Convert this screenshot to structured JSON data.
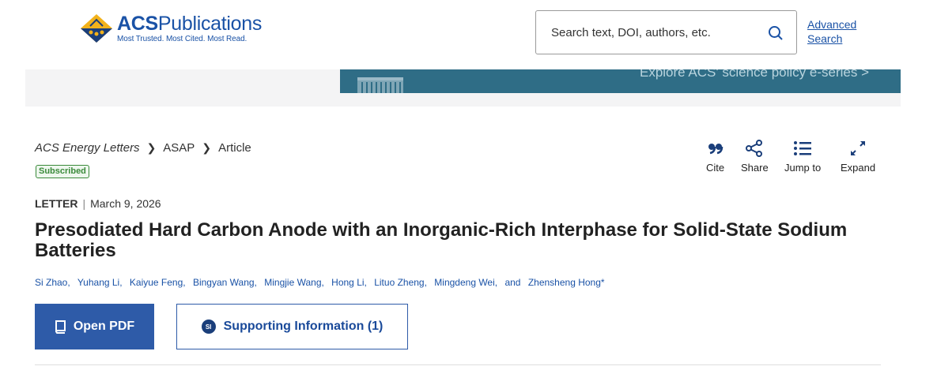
{
  "header": {
    "logo_title_bold": "ACS",
    "logo_title_rest": "Publications",
    "logo_tagline": "Most Trusted. Most Cited. Most Read.",
    "search_placeholder": "Search text, DOI, authors, etc.",
    "advanced_search": "Advanced Search"
  },
  "banner": {
    "text": "Explore ACS' science policy e-series >"
  },
  "breadcrumb": {
    "journal": "ACS Energy Letters",
    "section": "ASAP",
    "page": "Article"
  },
  "badge": "Subscribed",
  "tools": {
    "cite": "Cite",
    "share": "Share",
    "jump": "Jump to",
    "expand": "Expand"
  },
  "article": {
    "type": "LETTER",
    "date": "March 9, 2026",
    "title": "Presodiated Hard Carbon Anode with an Inorganic-Rich Interphase for Solid-State Sodium Batteries",
    "authors": [
      "Si Zhao,",
      "Yuhang Li,",
      "Kaiyue Feng,",
      "Bingyan Wang,",
      "Mingjie Wang,",
      "Hong Li,",
      "Lituo Zheng,",
      "Mingdeng Wei,",
      "and",
      "Zhensheng Hong*"
    ]
  },
  "buttons": {
    "open_pdf": "Open PDF",
    "si_icon": "SI",
    "supporting_info": "Supporting Information (1)"
  },
  "colors": {
    "brand_blue": "#1a52a6",
    "button_blue": "#2e5ba8",
    "banner_teal": "#2f6d86",
    "subscribed_green": "#3a8a3a"
  }
}
